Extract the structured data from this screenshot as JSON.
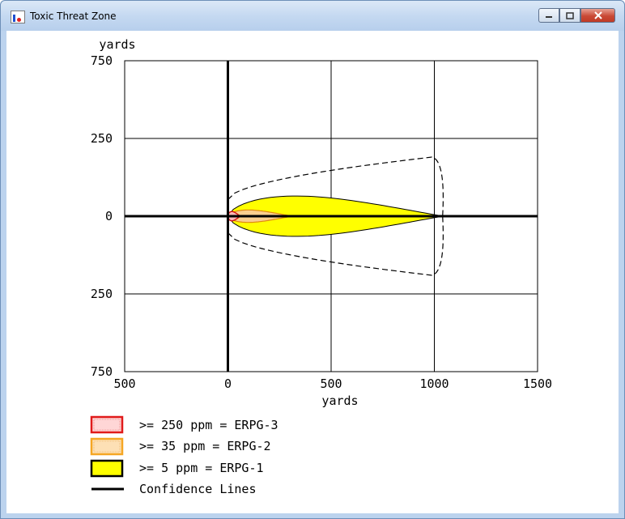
{
  "window": {
    "title": "Toxic Threat Zone",
    "title_icon": "chart-app-icon",
    "buttons": {
      "minimize": "minimize",
      "maximize": "maximize",
      "close": "close"
    }
  },
  "plot": {
    "y_axis_unit": "yards",
    "x_axis_unit": "yards",
    "y_ticks": [
      "750",
      "250",
      "0",
      "250",
      "750"
    ],
    "x_ticks": [
      "500",
      "0",
      "500",
      "1000",
      "1500"
    ]
  },
  "legend": {
    "items": [
      {
        "label": ">= 250 ppm = ERPG-3",
        "swatch_color": "#e01a1a"
      },
      {
        "label": ">= 35 ppm = ERPG-2",
        "swatch_color": "#f5a623"
      },
      {
        "label": ">= 5 ppm = ERPG-1",
        "swatch_color": "#ffff00"
      },
      {
        "label": "Confidence Lines",
        "swatch_color": "#000000"
      }
    ]
  },
  "chart_data": {
    "type": "area",
    "title": "",
    "xlabel": "yards",
    "ylabel": "yards",
    "xlim": [
      -500,
      1500
    ],
    "ylim": [
      -750,
      750
    ],
    "x_ticks": [
      -500,
      0,
      500,
      1000,
      1500
    ],
    "y_ticks": [
      -750,
      -250,
      0,
      250,
      750
    ],
    "grid": true,
    "zones": [
      {
        "name": ">= 250 ppm = ERPG-3",
        "color": "#e01a1a",
        "max_downwind": 60,
        "max_halfwidth": 15
      },
      {
        "name": ">= 35 ppm = ERPG-2",
        "color": "#f5a623",
        "max_downwind": 310,
        "max_halfwidth": 20
      },
      {
        "name": ">= 5 ppm = ERPG-1",
        "color": "#ffff00",
        "max_downwind": 1040,
        "max_halfwidth": 65
      }
    ],
    "confidence_lines": {
      "max_downwind": 1040,
      "max_halfwidth": 190
    }
  }
}
